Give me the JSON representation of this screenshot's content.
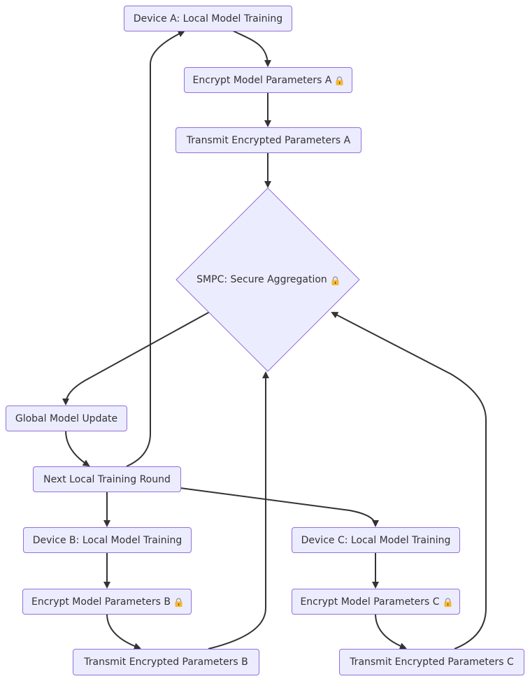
{
  "colors": {
    "node_fill": "#ECECFF",
    "node_stroke": "#9370DB",
    "edge": "#333333",
    "text": "#333333",
    "lock": "#F4B731"
  },
  "nodes": {
    "device_a": {
      "label": "Device A: Local Model Training"
    },
    "encrypt_a": {
      "label": "Encrypt Model Parameters A",
      "icon": "lock-icon"
    },
    "transmit_a": {
      "label": "Transmit Encrypted Parameters A"
    },
    "smpc": {
      "label": "SMPC: Secure Aggregation",
      "icon": "lock-icon"
    },
    "global_update": {
      "label": "Global Model Update"
    },
    "next_round": {
      "label": "Next Local Training Round"
    },
    "device_b": {
      "label": "Device B: Local Model Training"
    },
    "device_c": {
      "label": "Device C: Local Model Training"
    },
    "encrypt_b": {
      "label": "Encrypt Model Parameters B",
      "icon": "lock-icon"
    },
    "encrypt_c": {
      "label": "Encrypt Model Parameters C",
      "icon": "lock-icon"
    },
    "transmit_b": {
      "label": "Transmit Encrypted Parameters B"
    },
    "transmit_c": {
      "label": "Transmit Encrypted Parameters C"
    }
  }
}
